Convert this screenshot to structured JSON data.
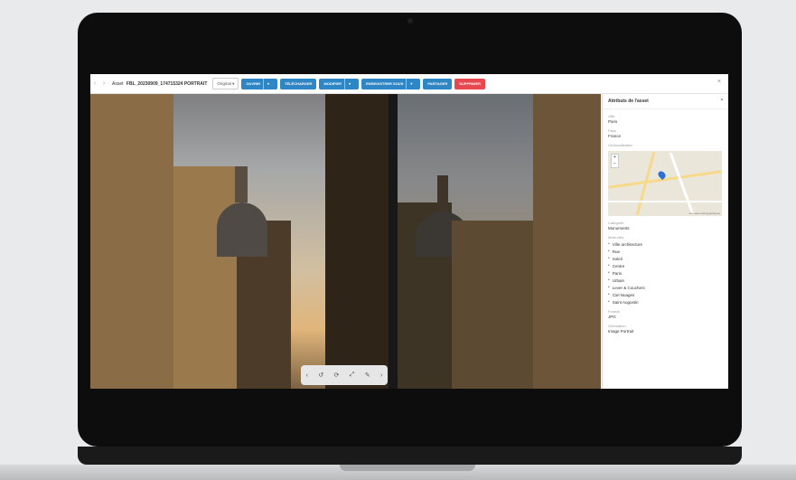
{
  "window": {
    "back_icon": "chevron-left-icon",
    "forward_icon": "chevron-right-icon",
    "asset_label": "Asset",
    "asset_name": "FBL_20230909_174715324 PORTRAIT",
    "version_select": "Original",
    "buttons": [
      {
        "label": "OUVRIR",
        "color": "#2f86c4",
        "has_caret": true
      },
      {
        "label": "TÉLÉCHARGER",
        "color": "#2f86c4",
        "has_caret": false
      },
      {
        "label": "MODIFIER",
        "color": "#2f86c4",
        "has_caret": true
      },
      {
        "label": "ENREGISTRER SOUS",
        "color": "#2f86c4",
        "has_caret": true
      },
      {
        "label": "PARTAGER",
        "color": "#2f86c4",
        "has_caret": false
      },
      {
        "label": "SUPPRIMER",
        "color": "#e8474f",
        "has_caret": false
      }
    ],
    "close_label": "×"
  },
  "viewer": {
    "toolbar_icons": [
      "‹",
      "↺",
      "⟳",
      "⤢",
      "✎",
      "›"
    ]
  },
  "panel": {
    "title": "Attributs de l'asset",
    "collapse_icon": "⌃",
    "fields": [
      {
        "label": "Ville",
        "value": "Paris"
      },
      {
        "label": "Pays",
        "value": "France"
      }
    ],
    "map_label": "Géolocalisation",
    "map_zoom_in": "+",
    "map_zoom_out": "−",
    "map_credit": "Données cartographiques",
    "subject_label": "Catégorie",
    "subject_value": "Monuments",
    "tags_label": "Mots-clés",
    "tags": [
      "Ville architecture",
      "Rue",
      "Soleil",
      "Centre",
      "Paris",
      "Urbain",
      "Lever & Couchers",
      "Ciel Nuages",
      "Saint Augustin"
    ],
    "format_label": "Format",
    "format_value": "JPG",
    "orientation_label": "Orientation",
    "orientation_value": "Image Portrait"
  }
}
